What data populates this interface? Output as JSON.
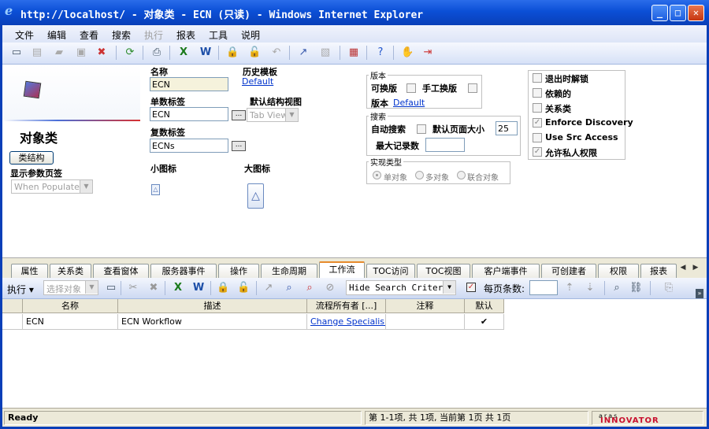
{
  "window": {
    "title": "http://localhost/ - 对象类 - ECN (只读) - Windows Internet Explorer"
  },
  "menu": [
    "文件",
    "编辑",
    "查看",
    "搜索",
    "执行",
    "报表",
    "工具",
    "说明"
  ],
  "form": {
    "page_title": "对象类",
    "class_structure_button": "类结构",
    "show_params_label": "显示参数页签",
    "show_params_value": "When Populated",
    "name_label": "名称",
    "name_value": "ECN",
    "history_template_label": "历史模板",
    "history_template_value": "Default",
    "singular_label_label": "单数标签",
    "singular_label_value": "ECN",
    "default_structure_view_label": "默认结构视图",
    "default_structure_view_value": "Tab View",
    "plural_label_label": "复数标签",
    "plural_label_value": "ECNs",
    "small_icon_label": "小图标",
    "large_icon_label": "大图标",
    "version_group": "版本",
    "versionable_label": "可换版",
    "manual_version_label": "手工换版",
    "version_label": "版本",
    "version_value": "Default",
    "search_group": "搜索",
    "auto_search_label": "自动搜索",
    "default_page_size_label": "默认页面大小",
    "default_page_size_value": "25",
    "max_records_label": "最大记录数",
    "max_records_value": "",
    "impl_type_group": "实现类型",
    "impl_single": "单对象",
    "impl_multi": "多对象",
    "impl_union": "联合对象",
    "flags": [
      {
        "label": "退出时解锁",
        "checked": false
      },
      {
        "label": "依赖的",
        "checked": false
      },
      {
        "label": "关系类",
        "checked": false
      },
      {
        "label": "Enforce Discovery",
        "checked": true
      },
      {
        "label": "Use Src Access",
        "checked": false
      },
      {
        "label": "允许私人权限",
        "checked": true
      }
    ]
  },
  "tabs": [
    "属性",
    "关系类",
    "查看窗体",
    "服务器事件",
    "操作",
    "生命周期",
    "工作流",
    "TOC访问",
    "TOC视图",
    "客户端事件",
    "可创建者",
    "权限",
    "报表"
  ],
  "active_tab": "工作流",
  "rel_toolbar": {
    "execute_label": "执行",
    "select_placeholder": "选择对象",
    "search_mode": "Hide Search Criteria",
    "page_size_label": "每页条数:"
  },
  "grid": {
    "columns": [
      "名称",
      "描述",
      "流程所有者 [...]",
      "注释",
      "默认"
    ],
    "rows": [
      {
        "name": "ECN",
        "description": "ECN Workflow",
        "owner": "Change Specialis...",
        "comments": "",
        "default": "✔"
      }
    ]
  },
  "status": {
    "left": "Ready",
    "middle": "第 1-1项, 共 1项, 当前第 1页 共 1页",
    "brand_top": "aras",
    "brand": "INNOVATOR"
  }
}
